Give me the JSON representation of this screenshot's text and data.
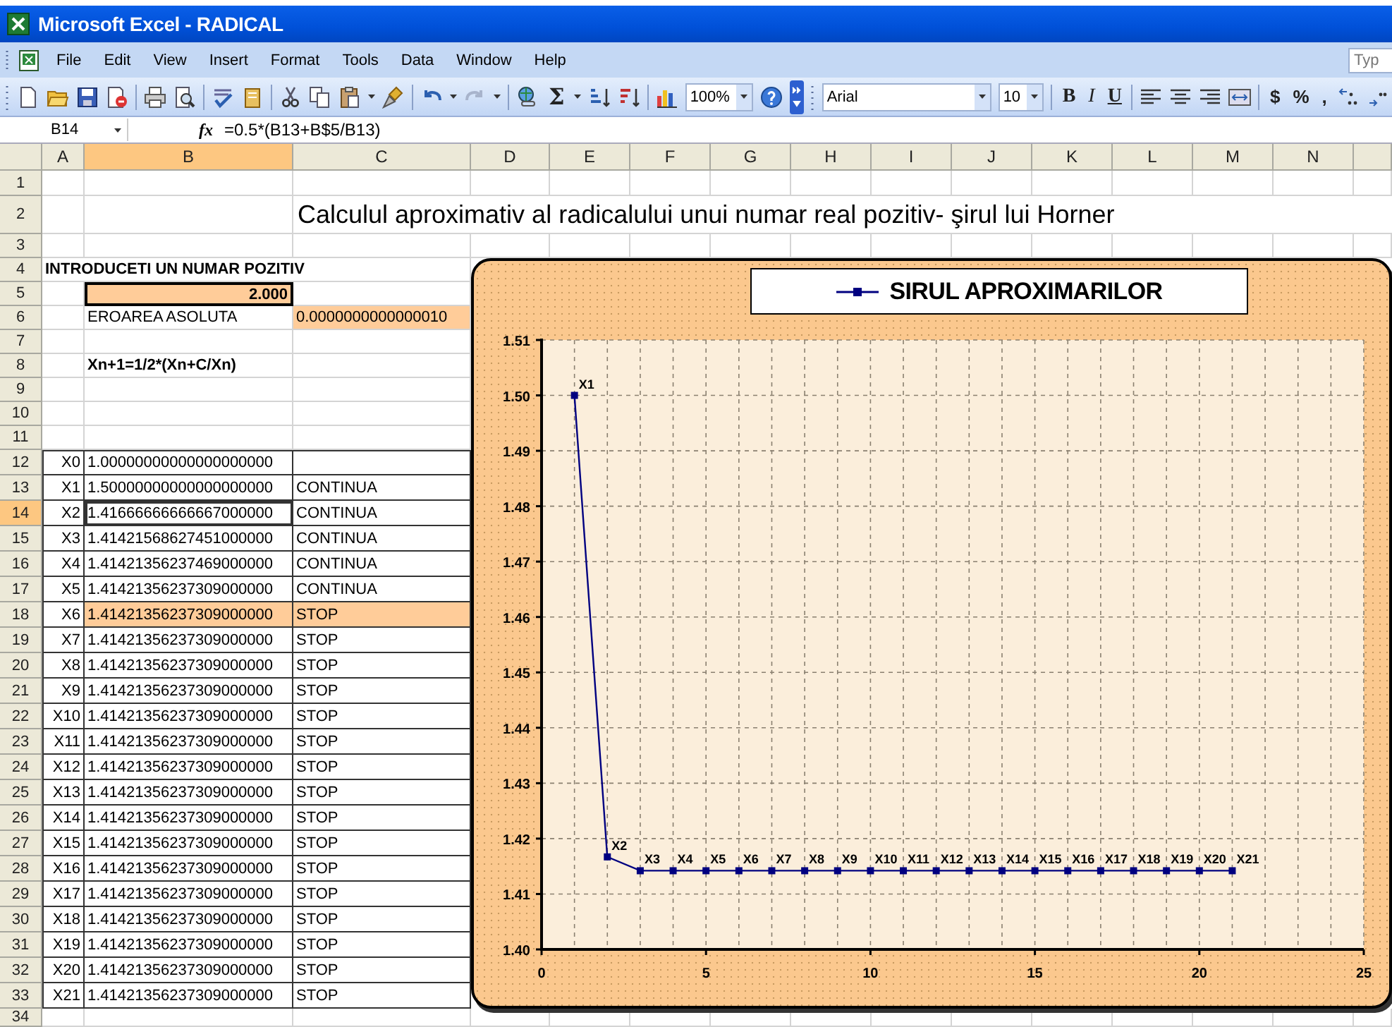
{
  "window": {
    "title": "Microsoft Excel - RADICAL"
  },
  "menu": {
    "items": [
      "File",
      "Edit",
      "View",
      "Insert",
      "Format",
      "Tools",
      "Data",
      "Window",
      "Help"
    ],
    "help_box": {
      "placeholder": "Typ"
    }
  },
  "toolbar": {
    "autosum": "Σ",
    "zoom": "100%",
    "font": "Arial",
    "size": "10",
    "format_buttons": [
      "B",
      "I",
      "U"
    ],
    "number_buttons": [
      "$",
      "%",
      ","
    ]
  },
  "formula_bar": {
    "name_box": "B14",
    "fx": "fx",
    "formula": "=0.5*(B13+B$5/B13)"
  },
  "columns": [
    {
      "label": "A",
      "selected": false
    },
    {
      "label": "B",
      "selected": true
    },
    {
      "label": "C",
      "selected": false
    },
    {
      "label": "D",
      "selected": false
    },
    {
      "label": "E",
      "selected": false
    },
    {
      "label": "F",
      "selected": false
    },
    {
      "label": "G",
      "selected": false
    },
    {
      "label": "H",
      "selected": false
    },
    {
      "label": "I",
      "selected": false
    },
    {
      "label": "J",
      "selected": false
    },
    {
      "label": "K",
      "selected": false
    },
    {
      "label": "L",
      "selected": false
    },
    {
      "label": "M",
      "selected": false
    },
    {
      "label": "N",
      "selected": false
    }
  ],
  "rows": [
    {
      "row": "1",
      "kind": "blank"
    },
    {
      "row": "2",
      "kind": "title",
      "text": "Calculul aproximativ al radicalului unui numar real pozitiv- şirul lui Horner"
    },
    {
      "row": "3",
      "kind": "blank"
    },
    {
      "row": "4",
      "kind": "heading",
      "text": "INTRODUCETI UN NUMAR POZITIV"
    },
    {
      "row": "5",
      "kind": "input",
      "value": "2.000"
    },
    {
      "row": "6",
      "kind": "parameter",
      "label": "EROAREA ASOLUTA",
      "value": "0.0000000000000010"
    },
    {
      "row": "7",
      "kind": "blank"
    },
    {
      "row": "8",
      "kind": "formula",
      "text": "Xn+1=1/2*(Xn+C/Xn)"
    },
    {
      "row": "9",
      "kind": "blank"
    },
    {
      "row": "10",
      "kind": "blank"
    },
    {
      "row": "11",
      "kind": "blank"
    }
  ],
  "iterations": [
    {
      "row": "12",
      "label": "X0",
      "value": "1.00000000000000000000",
      "highlighted": false,
      "selected": false
    },
    {
      "row": "13",
      "label": "X1",
      "value": "1.50000000000000000000",
      "status": "CONTINUA",
      "highlighted": false,
      "selected": false
    },
    {
      "row": "14",
      "label": "X2",
      "value": "1.41666666666667000000",
      "status": "CONTINUA",
      "highlighted": false,
      "selected": true
    },
    {
      "row": "15",
      "label": "X3",
      "value": "1.41421568627451000000",
      "status": "CONTINUA",
      "highlighted": false,
      "selected": false
    },
    {
      "row": "16",
      "label": "X4",
      "value": "1.41421356237469000000",
      "status": "CONTINUA",
      "highlighted": false,
      "selected": false
    },
    {
      "row": "17",
      "label": "X5",
      "value": "1.41421356237309000000",
      "status": "CONTINUA",
      "highlighted": false,
      "selected": false
    },
    {
      "row": "18",
      "label": "X6",
      "value": "1.41421356237309000000",
      "status": "STOP",
      "highlighted": true,
      "selected": false
    },
    {
      "row": "19",
      "label": "X7",
      "value": "1.41421356237309000000",
      "status": "STOP",
      "highlighted": false,
      "selected": false
    },
    {
      "row": "20",
      "label": "X8",
      "value": "1.41421356237309000000",
      "status": "STOP",
      "highlighted": false,
      "selected": false
    },
    {
      "row": "21",
      "label": "X9",
      "value": "1.41421356237309000000",
      "status": "STOP",
      "highlighted": false,
      "selected": false
    },
    {
      "row": "22",
      "label": "X10",
      "value": "1.41421356237309000000",
      "status": "STOP",
      "highlighted": false,
      "selected": false
    },
    {
      "row": "23",
      "label": "X11",
      "value": "1.41421356237309000000",
      "status": "STOP",
      "highlighted": false,
      "selected": false
    },
    {
      "row": "24",
      "label": "X12",
      "value": "1.41421356237309000000",
      "status": "STOP",
      "highlighted": false,
      "selected": false
    },
    {
      "row": "25",
      "label": "X13",
      "value": "1.41421356237309000000",
      "status": "STOP",
      "highlighted": false,
      "selected": false
    },
    {
      "row": "26",
      "label": "X14",
      "value": "1.41421356237309000000",
      "status": "STOP",
      "highlighted": false,
      "selected": false
    },
    {
      "row": "27",
      "label": "X15",
      "value": "1.41421356237309000000",
      "status": "STOP",
      "highlighted": false,
      "selected": false
    },
    {
      "row": "28",
      "label": "X16",
      "value": "1.41421356237309000000",
      "status": "STOP",
      "highlighted": false,
      "selected": false
    },
    {
      "row": "29",
      "label": "X17",
      "value": "1.41421356237309000000",
      "status": "STOP",
      "highlighted": false,
      "selected": false
    },
    {
      "row": "30",
      "label": "X18",
      "value": "1.41421356237309000000",
      "status": "STOP",
      "highlighted": false,
      "selected": false
    },
    {
      "row": "31",
      "label": "X19",
      "value": "1.41421356237309000000",
      "status": "STOP",
      "highlighted": false,
      "selected": false
    },
    {
      "row": "32",
      "label": "X20",
      "value": "1.41421356237309000000",
      "status": "STOP",
      "highlighted": false,
      "selected": false
    },
    {
      "row": "33",
      "label": "X21",
      "value": "1.41421356237309000000",
      "status": "STOP",
      "highlighted": false,
      "selected": false
    }
  ],
  "trailing_rows": [
    {
      "row": "34",
      "kind": "blank"
    }
  ],
  "chart": {
    "chart_data": {
      "type": "line",
      "x": [
        1,
        2,
        3,
        4,
        5,
        6,
        7,
        8,
        9,
        10,
        11,
        12,
        13,
        14,
        15,
        16,
        17,
        18,
        19,
        20,
        21
      ],
      "series": [
        {
          "name": "SIRUL APROXIMARILOR",
          "color": "#000080",
          "marker": "square",
          "values": [
            1.5,
            1.4167,
            1.4142,
            1.4142,
            1.4142,
            1.4142,
            1.4142,
            1.4142,
            1.4142,
            1.4142,
            1.4142,
            1.4142,
            1.4142,
            1.4142,
            1.4142,
            1.4142,
            1.4142,
            1.4142,
            1.4142,
            1.4142,
            1.4142
          ]
        }
      ],
      "grid": true,
      "xlim": [
        0,
        25
      ],
      "ylim": [
        1.4,
        1.51
      ],
      "xticks": [
        0,
        5,
        10,
        15,
        20,
        25
      ],
      "yticks": [
        {
          "value": 1.4,
          "label": "1.40"
        },
        {
          "value": 1.41,
          "label": "1.41"
        },
        {
          "value": 1.42,
          "label": "1.42"
        },
        {
          "value": 1.43,
          "label": "1.43"
        },
        {
          "value": 1.44,
          "label": "1.44"
        },
        {
          "value": 1.45,
          "label": "1.45"
        },
        {
          "value": 1.46,
          "label": "1.46"
        },
        {
          "value": 1.47,
          "label": "1.47"
        },
        {
          "value": 1.48,
          "label": "1.48"
        },
        {
          "value": 1.49,
          "label": "1.49"
        },
        {
          "value": 1.5,
          "label": "1.50"
        },
        {
          "value": 1.51,
          "label": "1.51"
        }
      ],
      "value_labels": [
        "X1",
        "X2",
        "X3",
        "X4",
        "X5",
        "X6",
        "X7",
        "X8",
        "X9",
        "X10",
        "X11",
        "X12",
        "X13",
        "X14",
        "X15",
        "X16",
        "X17",
        "X18",
        "X19",
        "X20",
        "X21"
      ]
    }
  }
}
